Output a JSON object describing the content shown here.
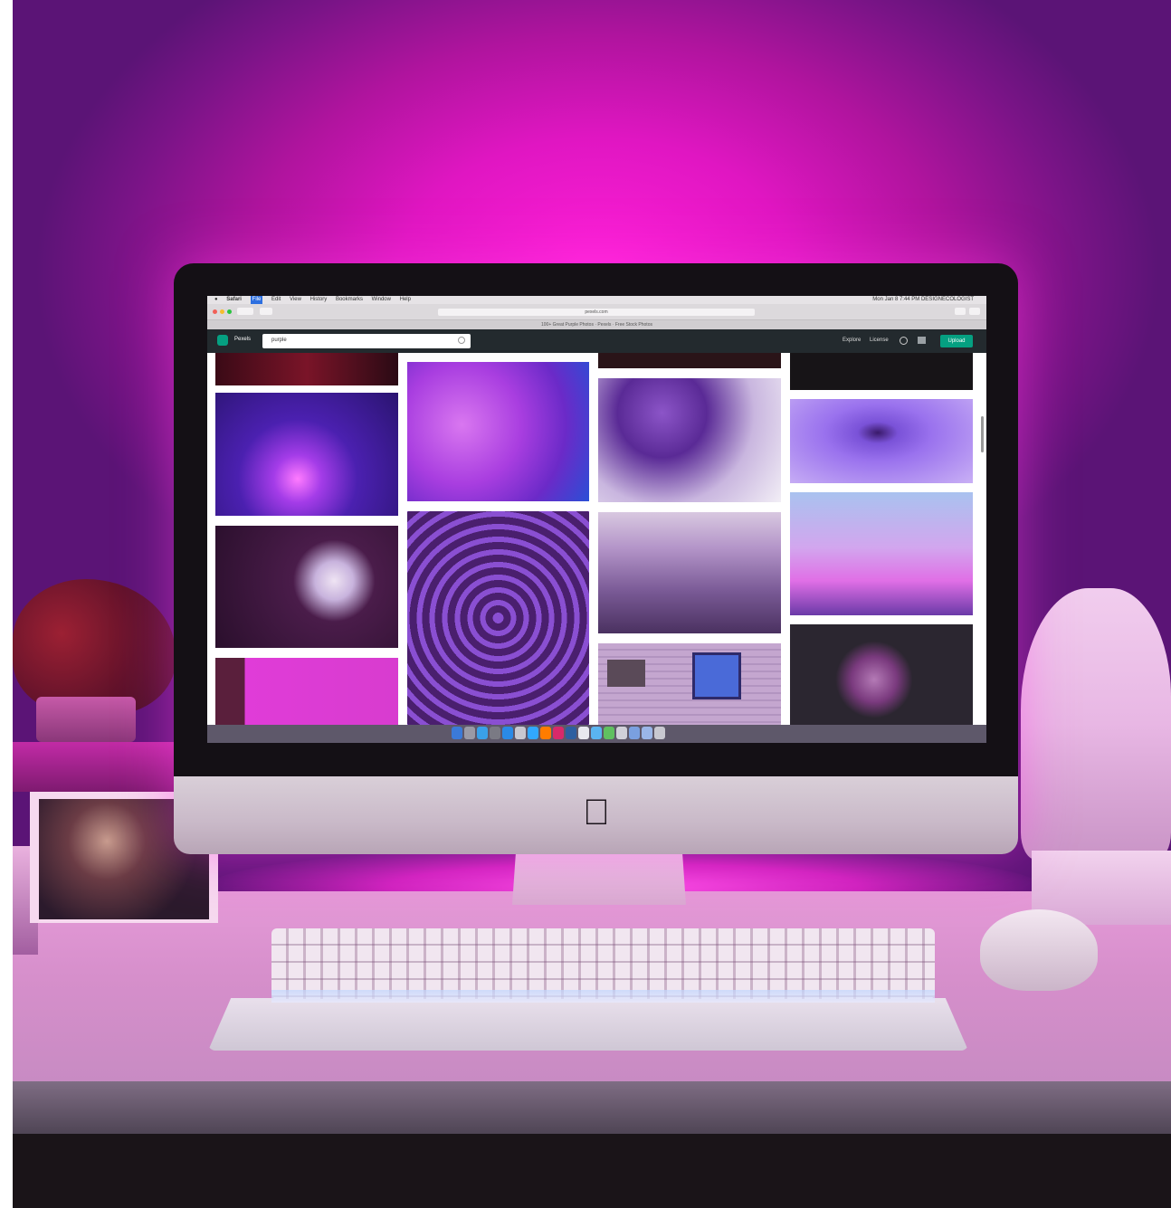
{
  "menubar": {
    "items": [
      "Safari",
      "File",
      "Edit",
      "View",
      "History",
      "Bookmarks",
      "Window",
      "Help"
    ],
    "status": "Mon Jan 8 7:44 PM  DESIGNECOLOGIST"
  },
  "browser": {
    "url": "pexels.com",
    "tab_title": "100+ Great Purple Photos · Pexels · Free Stock Photos"
  },
  "app": {
    "brand": "Pexels",
    "search_value": "purple",
    "nav": [
      "Explore",
      "License"
    ],
    "upload_label": "Upload",
    "accent_color": "#05a081"
  },
  "photos": [
    {
      "subject": "dark red sparkle",
      "color": "#5a1020"
    },
    {
      "subject": "fiber optic lamp",
      "color": "#3b1a8a"
    },
    {
      "subject": "daisy on dark purple",
      "color": "#3a1438"
    },
    {
      "subject": "pink abstract",
      "color": "#c230c8"
    },
    {
      "subject": "purple smoke ink",
      "color": "#a33be0"
    },
    {
      "subject": "purple flower field",
      "color": "#4a1f6e"
    },
    {
      "subject": "purple balloons",
      "color": "#6b2fa0"
    },
    {
      "subject": "allium field",
      "color": "#8c6aa6"
    },
    {
      "subject": "purple wooden house",
      "color": "#b79ac7"
    },
    {
      "subject": "water ripple",
      "color": "#7a52d8"
    },
    {
      "subject": "birds at sunset",
      "color": "#c58ae6"
    },
    {
      "subject": "purple chrysanthemum",
      "color": "#2b2630"
    }
  ]
}
